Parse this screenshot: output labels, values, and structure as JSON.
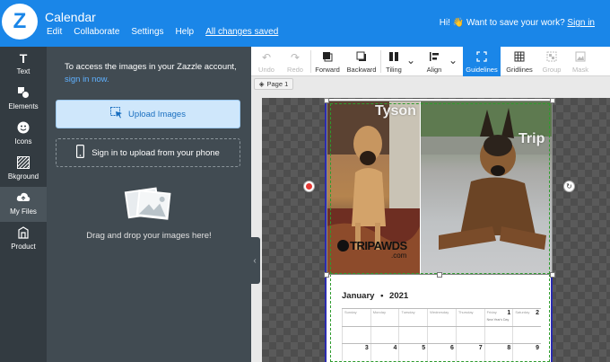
{
  "app": {
    "logo_letter": "Z",
    "title": "Calendar",
    "menu": [
      "Edit",
      "Collaborate",
      "Settings",
      "Help"
    ],
    "saved_status": "All changes saved",
    "save_prompt": "Hi! 👋 Want to save your work?",
    "sign_in": "Sign in"
  },
  "rail": [
    {
      "label": "Text",
      "icon": "text-icon"
    },
    {
      "label": "Elements",
      "icon": "elements-icon"
    },
    {
      "label": "Icons",
      "icon": "smiley-icon"
    },
    {
      "label": "Bkground",
      "icon": "background-icon"
    },
    {
      "label": "My Files",
      "icon": "cloud-upload-icon",
      "active": true
    },
    {
      "label": "Product",
      "icon": "product-icon"
    }
  ],
  "panel": {
    "message": "To access the images in your Zazzle account,",
    "message_link": "sign in now.",
    "upload_label": "Upload Images",
    "phone_label": "Sign in to upload from your phone",
    "drop_text": "Drag and drop your images here!"
  },
  "toolbar": {
    "undo": "Undo",
    "redo": "Redo",
    "forward": "Forward",
    "backward": "Backward",
    "tiling": "Tiling",
    "align": "Align",
    "guidelines": "Guidelines",
    "gridlines": "Gridlines",
    "group": "Group",
    "mask": "Mask"
  },
  "page_tab": "Page 1",
  "design": {
    "left_dog": "Tyson",
    "right_dog": "Trip",
    "watermark": "TRIPAWDS",
    "watermark_sub": ".com",
    "month": "January",
    "year": "2021",
    "weekdays": [
      "Sunday",
      "Monday",
      "Tuesday",
      "Wednesday",
      "Thursday",
      "Friday",
      "Saturday"
    ],
    "row1": [
      "",
      "",
      "",
      "",
      "",
      "1",
      "2"
    ],
    "row2": [
      "3",
      "4",
      "5",
      "6",
      "7",
      "8",
      "9"
    ],
    "holiday": "New Year's Day"
  },
  "colors": {
    "brand_blue": "#1a86e8",
    "panel_dark": "#414b52",
    "rail_dark": "#333b41",
    "guide_green": "#2e9b2e"
  }
}
